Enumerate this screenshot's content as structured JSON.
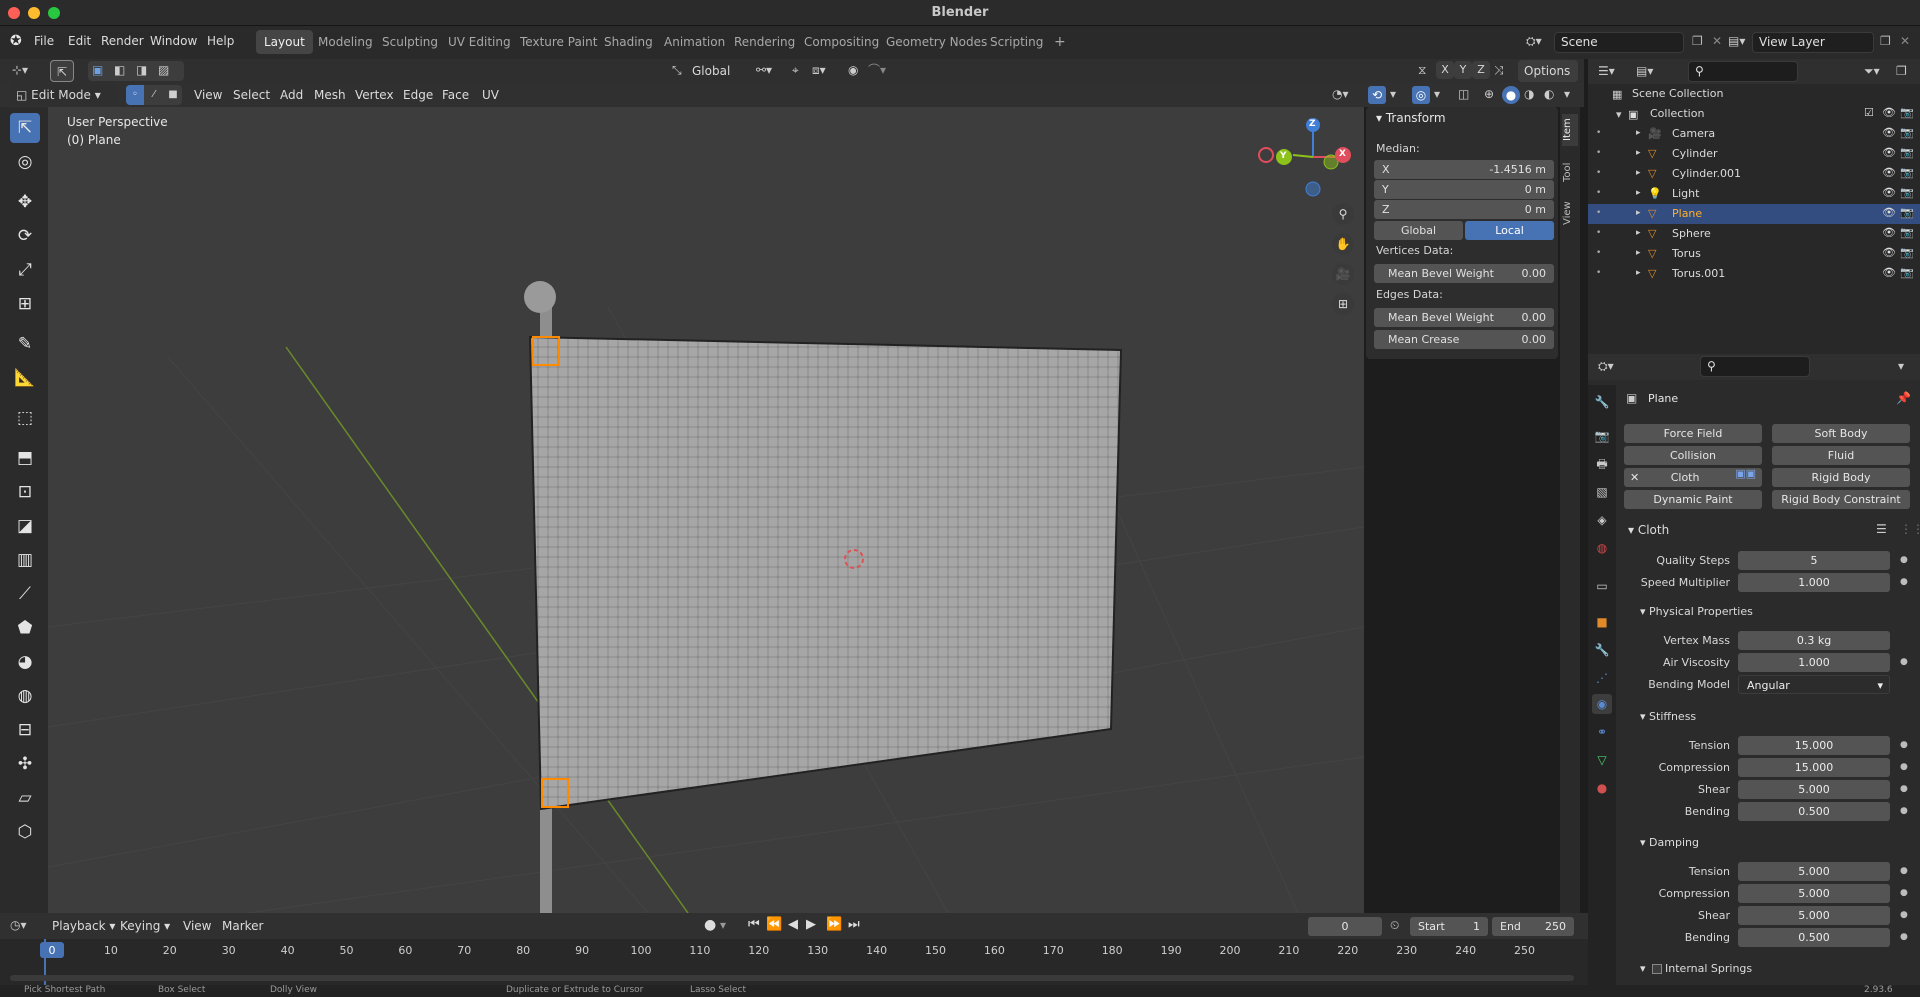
{
  "window": {
    "title": "Blender"
  },
  "menu": {
    "items": [
      "File",
      "Edit",
      "Render",
      "Window",
      "Help"
    ],
    "workspaces": [
      "Layout",
      "Modeling",
      "Sculpting",
      "UV Editing",
      "Texture Paint",
      "Shading",
      "Animation",
      "Rendering",
      "Compositing",
      "Geometry Nodes",
      "Scripting"
    ],
    "add_tab": "+",
    "scene": "Scene",
    "view_layer": "View Layer"
  },
  "viewport_header": {
    "mode": "Edit Mode",
    "menus": [
      "View",
      "Select",
      "Add",
      "Mesh",
      "Vertex",
      "Edge",
      "Face",
      "UV"
    ],
    "orientation": "Global",
    "axes": [
      "X",
      "Y",
      "Z"
    ],
    "options": "Options"
  },
  "viewport": {
    "perspective": "User Perspective",
    "object": "(0) Plane",
    "gizmo": {
      "x": "X",
      "y": "Y",
      "z": "Z"
    }
  },
  "npanel": {
    "tabs": [
      "Item",
      "Tool",
      "View"
    ],
    "title": "Transform",
    "median_label": "Median:",
    "x_label": "X",
    "x_value": "-1.4516 m",
    "y_label": "Y",
    "y_value": "0 m",
    "z_label": "Z",
    "z_value": "0 m",
    "global": "Global",
    "local": "Local",
    "vertices_data": "Vertices Data:",
    "v_bevel_label": "Mean Bevel Weight",
    "v_bevel_value": "0.00",
    "edges_data": "Edges Data:",
    "e_bevel_label": "Mean Bevel Weight",
    "e_bevel_value": "0.00",
    "crease_label": "Mean Crease",
    "crease_value": "0.00"
  },
  "outliner": {
    "root": "Scene Collection",
    "collection": "Collection",
    "items": [
      {
        "name": "Camera",
        "type": "camera"
      },
      {
        "name": "Cylinder",
        "type": "mesh"
      },
      {
        "name": "Cylinder.001",
        "type": "mesh"
      },
      {
        "name": "Light",
        "type": "light"
      },
      {
        "name": "Plane",
        "type": "mesh",
        "selected": true
      },
      {
        "name": "Sphere",
        "type": "mesh"
      },
      {
        "name": "Torus",
        "type": "mesh"
      },
      {
        "name": "Torus.001",
        "type": "mesh"
      }
    ]
  },
  "properties": {
    "object": "Plane",
    "physics": [
      "Force Field",
      "Soft Body",
      "Collision",
      "Fluid",
      "Cloth",
      "Rigid Body",
      "Dynamic Paint",
      "Rigid Body Constraint"
    ],
    "cloth": "Cloth",
    "quality_label": "Quality Steps",
    "quality_value": "5",
    "speed_label": "Speed Multiplier",
    "speed_value": "1.000",
    "physical_props": "Physical Properties",
    "mass_label": "Vertex Mass",
    "mass_value": "0.3 kg",
    "air_label": "Air Viscosity",
    "air_value": "1.000",
    "bending_model_label": "Bending Model",
    "bending_model_value": "Angular",
    "stiffness": "Stiffness",
    "s_tension_label": "Tension",
    "s_tension_value": "15.000",
    "s_compression_label": "Compression",
    "s_compression_value": "15.000",
    "s_shear_label": "Shear",
    "s_shear_value": "5.000",
    "s_bending_label": "Bending",
    "s_bending_value": "0.500",
    "damping": "Damping",
    "d_tension_label": "Tension",
    "d_tension_value": "5.000",
    "d_compression_label": "Compression",
    "d_compression_value": "5.000",
    "d_shear_label": "Shear",
    "d_shear_value": "5.000",
    "d_bending_label": "Bending",
    "d_bending_value": "0.500",
    "internal_springs": "Internal Springs"
  },
  "timeline": {
    "menus": [
      "Playback",
      "Keying",
      "View",
      "Marker"
    ],
    "current_frame": "0",
    "start_label": "Start",
    "start_value": "1",
    "end_label": "End",
    "end_value": "250",
    "ticks": [
      "0",
      "10",
      "20",
      "30",
      "40",
      "50",
      "60",
      "70",
      "80",
      "90",
      "100",
      "110",
      "120",
      "130",
      "140",
      "150",
      "160",
      "170",
      "180",
      "190",
      "200",
      "210",
      "220",
      "230",
      "240",
      "250"
    ]
  },
  "statusbar": {
    "items": [
      "Pick Shortest Path",
      "Box Select",
      "Dolly View",
      "Duplicate or Extrude to Cursor",
      "Lasso Select"
    ],
    "version": "2.93.6"
  }
}
